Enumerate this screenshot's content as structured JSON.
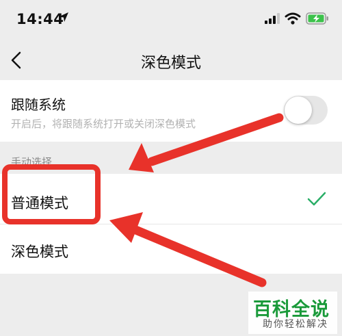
{
  "status": {
    "time": "14:44"
  },
  "nav": {
    "title": "深色模式"
  },
  "follow_system": {
    "title": "跟随系统",
    "description": "开启后，将跟随系统打开或关闭深色模式",
    "enabled": false
  },
  "manual": {
    "header": "手动选择",
    "options": [
      {
        "label": "普通模式",
        "selected": true
      },
      {
        "label": "深色模式",
        "selected": false
      }
    ]
  },
  "annotation_color": "#e8322a",
  "watermark": {
    "brand": "百科全说",
    "slogan": "助你轻松解决"
  }
}
